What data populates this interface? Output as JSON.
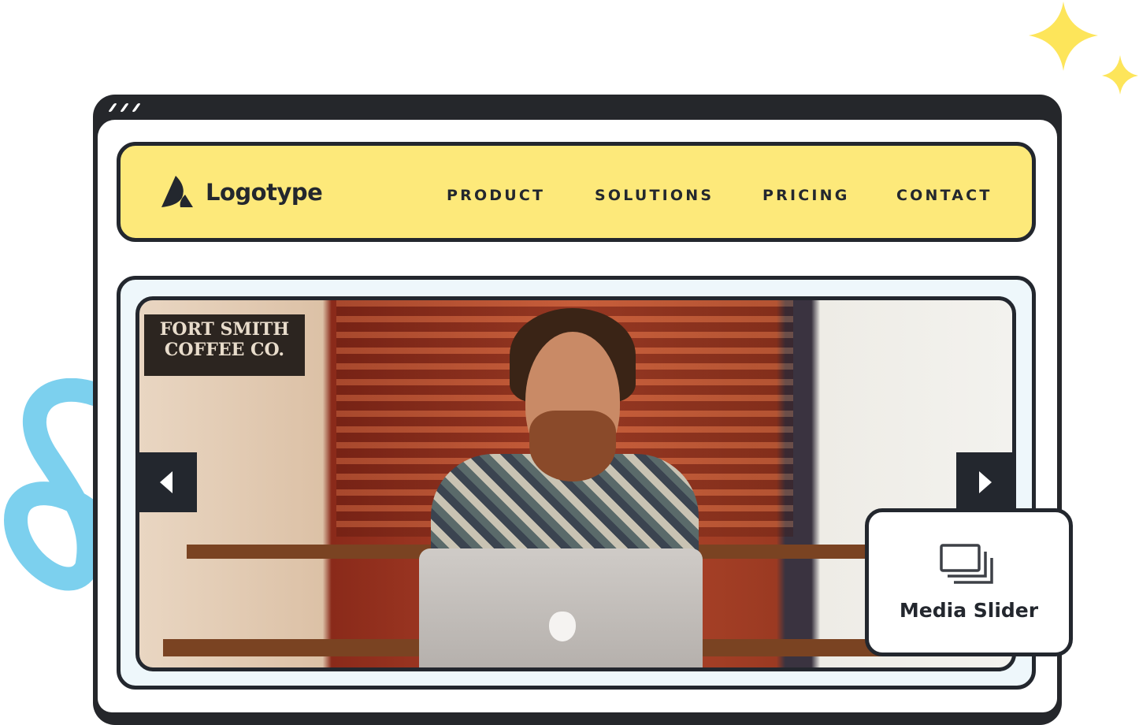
{
  "nav": {
    "logo_text": "Logotype",
    "links": [
      "PRODUCT",
      "SOLUTIONS",
      "PRICING",
      "CONTACT"
    ]
  },
  "slider": {
    "photo_sign_text": "FORT SMITH COFFEE CO.",
    "prev_icon": "chevron-left",
    "next_icon": "chevron-right"
  },
  "card": {
    "icon": "stacked-slides-icon",
    "label": "Media Slider"
  },
  "colors": {
    "nav_bg": "#fde97a",
    "frame": "#23272e",
    "slider_bg": "#eef7fb",
    "stars": "#fde55a",
    "squiggle": "#7cd0ee"
  }
}
